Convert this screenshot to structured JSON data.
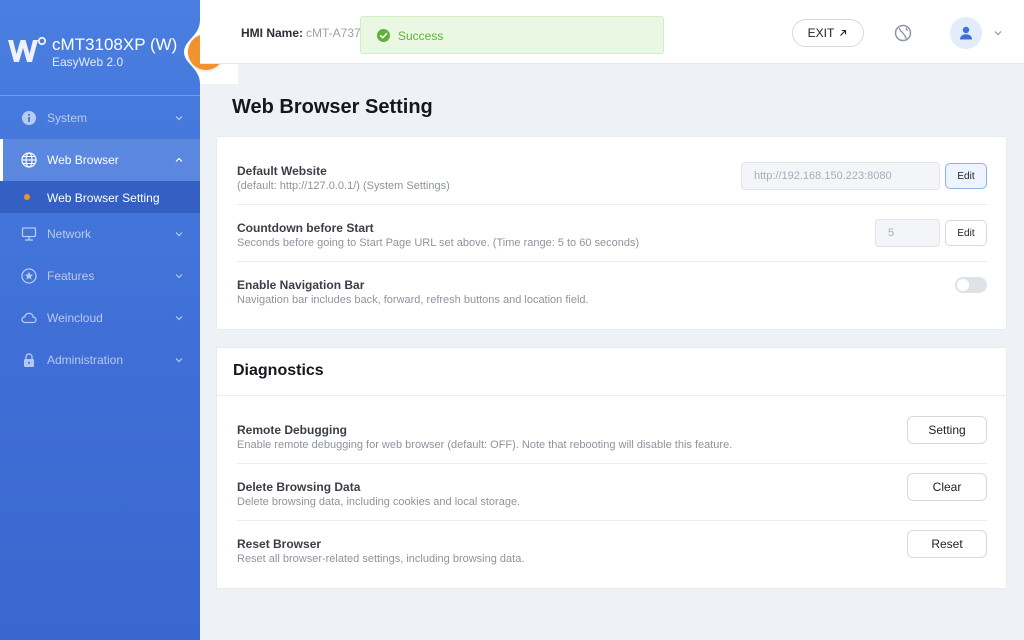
{
  "brand": {
    "title": "cMT3108XP (W)",
    "subtitle": "EasyWeb 2.0"
  },
  "sidebar": {
    "items": [
      {
        "label": "System",
        "icon": "info-icon"
      },
      {
        "label": "Web Browser",
        "icon": "globe-icon",
        "active": true
      },
      {
        "label": "Network",
        "icon": "monitor-network-icon"
      },
      {
        "label": "Features",
        "icon": "star-icon"
      },
      {
        "label": "Weincloud",
        "icon": "cloud-icon"
      },
      {
        "label": "Administration",
        "icon": "lock-icon"
      }
    ],
    "sub_item": {
      "label": "Web Browser Setting"
    }
  },
  "topbar": {
    "hmi_label": "HMI Name:",
    "hmi_value": "cMT-A737",
    "toast": "Success",
    "exit": "EXIT"
  },
  "page": {
    "title": "Web Browser Setting"
  },
  "settings": {
    "default_website": {
      "title": "Default Website",
      "desc": "(default: http://127.0.0.1/) (System Settings)",
      "value": "http://192.168.150.223:8080",
      "button": "Edit"
    },
    "countdown": {
      "title": "Countdown before Start",
      "desc": "Seconds before going to Start Page URL set above. (Time range: 5 to 60 seconds)",
      "value": "5",
      "button": "Edit"
    },
    "navbar": {
      "title": "Enable Navigation Bar",
      "desc": "Navigation bar includes back, forward, refresh buttons and location field.",
      "enabled": false
    }
  },
  "diagnostics": {
    "title": "Diagnostics",
    "remote_debugging": {
      "title": "Remote Debugging",
      "desc": "Enable remote debugging for web browser (default: OFF). Note that rebooting will disable this feature.",
      "button": "Setting"
    },
    "delete_data": {
      "title": "Delete Browsing Data",
      "desc": "Delete browsing data, including cookies and local storage.",
      "button": "Clear"
    },
    "reset": {
      "title": "Reset Browser",
      "desc": "Reset all browser-related settings, including browsing data.",
      "button": "Reset"
    }
  },
  "colors": {
    "accent": "#3f6fd6",
    "orange": "#f2922c",
    "success": "#5fb13b"
  }
}
